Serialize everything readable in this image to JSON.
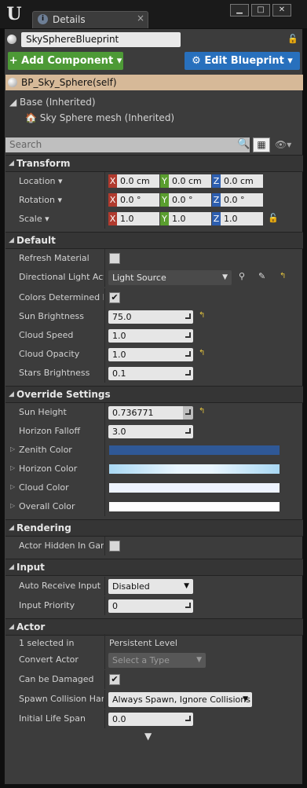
{
  "window": {
    "tab_title": "Details",
    "tab_close": "×",
    "btn_min": "▁",
    "btn_max": "□",
    "btn_close": "✕"
  },
  "actor": {
    "name": "SkySphereBlueprint",
    "self_label": "BP_Sky_Sphere(self)"
  },
  "buttons": {
    "add_component": "+ Add Component ▾",
    "edit_blueprint": "⚙ Edit Blueprint ▾"
  },
  "tree": {
    "base": "◢ Base (Inherited)",
    "mesh": "🏠 Sky Sphere mesh (Inherited)"
  },
  "search": {
    "placeholder": "Search"
  },
  "sections": {
    "transform": "Transform",
    "default": "Default",
    "override": "Override Settings",
    "rendering": "Rendering",
    "input": "Input",
    "actor": "Actor"
  },
  "transform": {
    "location_label": "Location ▾",
    "rotation_label": "Rotation ▾",
    "scale_label": "Scale ▾",
    "location": [
      "0.0 cm",
      "0.0 cm",
      "0.0 cm"
    ],
    "rotation": [
      "0.0 °",
      "0.0 °",
      "0.0 °"
    ],
    "scale": [
      "1.0",
      "1.0",
      "1.0"
    ],
    "axis": [
      "X",
      "Y",
      "Z"
    ]
  },
  "default": {
    "refresh_material": "Refresh Material",
    "directional_light": "Directional Light Acto",
    "directional_light_value": "Light Source",
    "colors_determined": "Colors Determined By",
    "sun_brightness": "Sun Brightness",
    "sun_brightness_value": "75.0",
    "cloud_speed": "Cloud Speed",
    "cloud_speed_value": "1.0",
    "cloud_opacity": "Cloud Opacity",
    "cloud_opacity_value": "1.0",
    "stars_brightness": "Stars Brightness",
    "stars_brightness_value": "0.1"
  },
  "override": {
    "sun_height": "Sun Height",
    "sun_height_value": "0.736771",
    "horizon_falloff": "Horizon Falloff",
    "horizon_falloff_value": "3.0",
    "zenith_color": "Zenith Color",
    "horizon_color": "Horizon Color",
    "cloud_color": "Cloud Color",
    "overall_color": "Overall Color",
    "colors": {
      "zenith": "#2f5896",
      "horizon": "#bfe3f7",
      "cloud": "#eef4ff",
      "overall": "#ffffff"
    }
  },
  "rendering": {
    "actor_hidden": "Actor Hidden In Game"
  },
  "input": {
    "auto_receive": "Auto Receive Input",
    "auto_receive_value": "Disabled",
    "input_priority": "Input Priority",
    "input_priority_value": "0"
  },
  "actor_section": {
    "selected": "1 selected in",
    "selected_value": "Persistent Level",
    "convert": "Convert Actor",
    "convert_value": "Select a Type",
    "damaged": "Can be Damaged",
    "spawn": "Spawn Collision Hand",
    "spawn_value": "Always Spawn, Ignore Collisions",
    "life_span": "Initial Life Span",
    "life_span_value": "0.0"
  },
  "glyphs": {
    "check": "✔",
    "reset": "↰",
    "caret": "▼",
    "section_arrow": "◢",
    "expand": "▷",
    "search": "🔍",
    "grid": "▦",
    "eye": "👁▾",
    "lock": "🔓",
    "bottom": "▼",
    "collapse": "▾",
    "picker": "⚲",
    "pipette": "✎"
  }
}
